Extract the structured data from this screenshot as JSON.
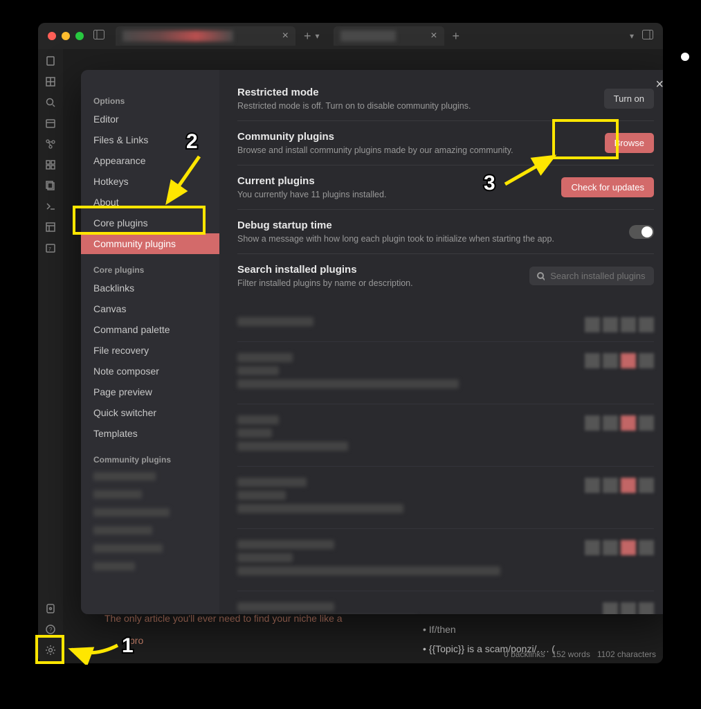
{
  "annotations": {
    "step1": "1",
    "step2": "2",
    "step3": "3"
  },
  "sidebar": {
    "group_options": "Options",
    "items_options": [
      "Editor",
      "Files & Links",
      "Appearance",
      "Hotkeys",
      "About",
      "Core plugins",
      "Community plugins"
    ],
    "group_core": "Core plugins",
    "items_core": [
      "Backlinks",
      "Canvas",
      "Command palette",
      "File recovery",
      "Note composer",
      "Page preview",
      "Quick switcher",
      "Templates"
    ],
    "group_community": "Community plugins"
  },
  "settings": {
    "restricted": {
      "title": "Restricted mode",
      "desc": "Restricted mode is off. Turn on to disable community plugins.",
      "btn": "Turn on"
    },
    "community": {
      "title": "Community plugins",
      "desc": "Browse and install community plugins made by our amazing community.",
      "btn": "Browse"
    },
    "current": {
      "title": "Current plugins",
      "desc": "You currently have 11 plugins installed.",
      "btn": "Check for updates"
    },
    "debug": {
      "title": "Debug startup time",
      "desc": "Show a message with how long each plugin took to initialize when starting the app."
    },
    "search": {
      "title": "Search installed plugins",
      "desc": "Filter installed plugins by name or description.",
      "placeholder": "Search installed plugins"
    }
  },
  "editor": {
    "article": "The only article you'll ever need to find your niche like a",
    "pro": "pro",
    "bullets": [
      "If/then",
      "{{Topic}} is a scam/ponzi/…. ("
    ]
  },
  "status": {
    "backlinks": "0 backlinks",
    "words": "152 words",
    "chars": "1102 characters"
  }
}
